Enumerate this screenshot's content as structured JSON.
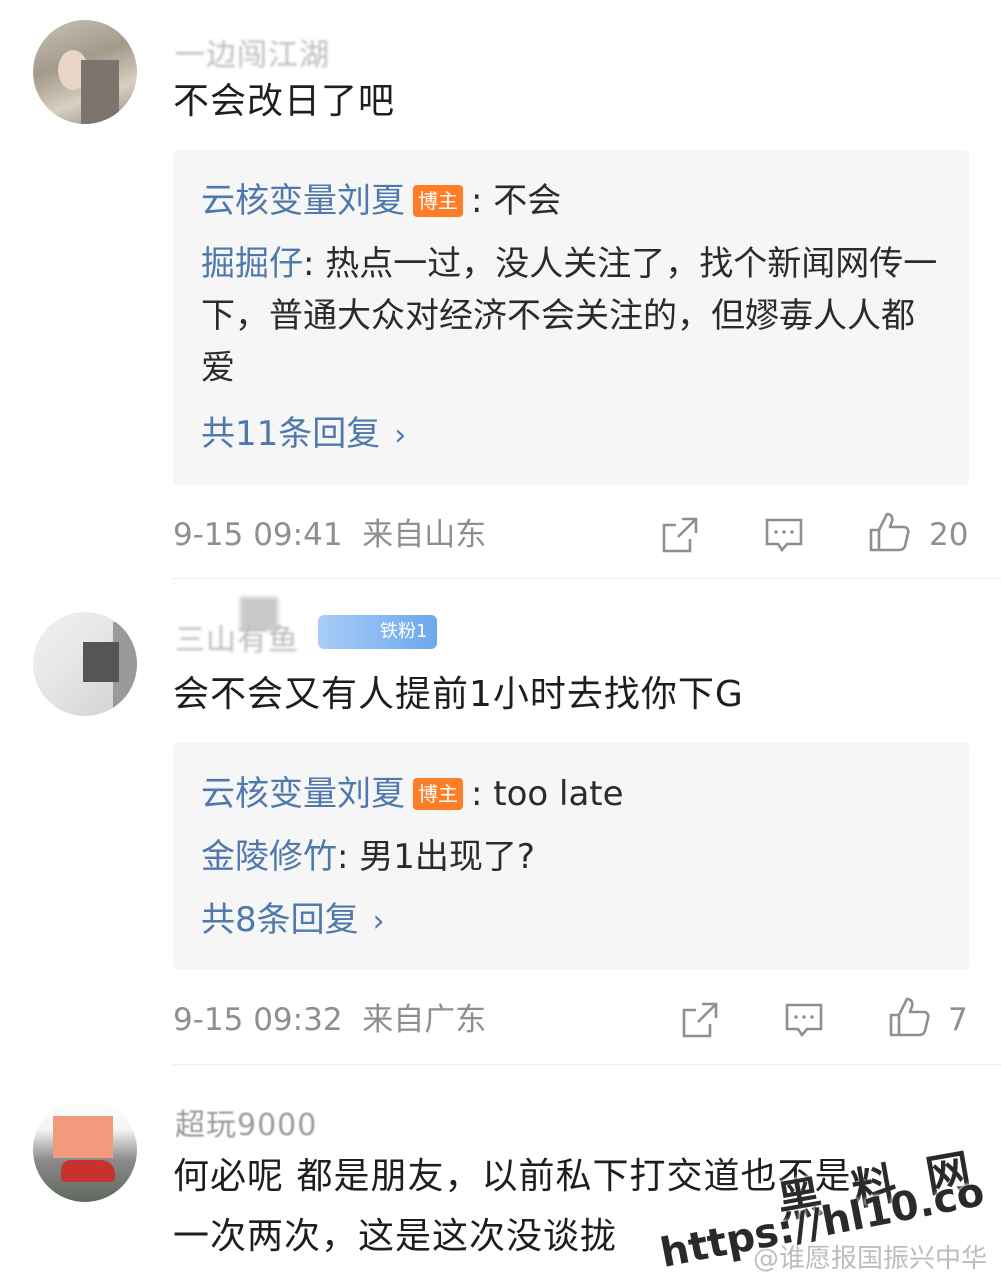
{
  "comments": [
    {
      "username": "一边闯江湖",
      "text": "不会改日了吧",
      "replies": {
        "line1_name": "云核变量刘夏",
        "line1_badge": "博主",
        "line1_text": ": 不会",
        "line2_name": "掘掘仔",
        "line2_text": ": 热点一过，没人关注了，找个新闻网传一下，普通大众对经济不会关注的，但嫪毐人人都爱",
        "more": "共11条回复"
      },
      "time": "9-15 09:41",
      "location": "来自山东",
      "likes": "20"
    },
    {
      "username": "三山有鱼",
      "fan_badge": "铁粉1",
      "text": "会不会又有人提前1小时去找你下G",
      "replies": {
        "line1_name": "云核变量刘夏",
        "line1_badge": "博主",
        "line1_text": ": too late",
        "line2_name": "金陵修竹",
        "line2_text": ": 男1出现了?",
        "more": "共8条回复"
      },
      "time": "9-15 09:32",
      "location": "来自广东",
      "likes": "7"
    },
    {
      "username": "超玩9000",
      "text_line1": "何必呢 都是朋友，以前私下打交道也不是",
      "text_line2": "一次两次，这是这次没谈拢"
    }
  ],
  "watermark": {
    "brand": "黑 料 网",
    "url": "https://hl10.co",
    "source": "@谁愿报国振兴中华"
  },
  "icons": {
    "share": "share-icon",
    "comment": "comment-icon",
    "like": "thumbs-up-icon",
    "chevron": "chevron-right-icon"
  },
  "colors": {
    "link": "#4f79ad",
    "badge": "#ff7d26",
    "meta": "#8f8f8f"
  }
}
